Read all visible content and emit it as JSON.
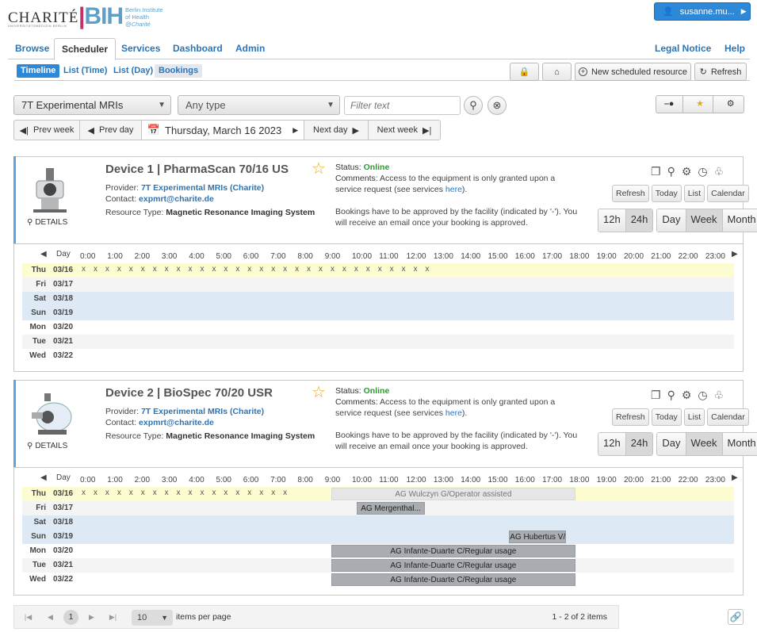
{
  "header": {
    "charite": "CHARITÉ",
    "charite_sub": "UNIVERSITÄTSMEDIZIN BERLIN",
    "bih_logo": "BIH",
    "bih_sub1": "Berlin Institute",
    "bih_sub2": "of Health",
    "bih_sub3": "@Charité",
    "user": "susanne.mu..."
  },
  "main_tabs": {
    "browse": "Browse",
    "scheduler": "Scheduler",
    "services": "Services",
    "dashboard": "Dashboard",
    "admin": "Admin",
    "legal": "Legal Notice",
    "help": "Help"
  },
  "sub_tabs": {
    "timeline": "Timeline",
    "list_time": "List (Time)",
    "list_day": "List (Day)",
    "bookings": "Bookings"
  },
  "toolbar": {
    "new_resource": "New scheduled resource",
    "refresh": "Refresh"
  },
  "filters": {
    "resource_group": "7T Experimental MRIs",
    "type": "Any type",
    "filter_placeholder": "Filter text"
  },
  "datebar": {
    "prev_week": "Prev week",
    "prev_day": "Prev day",
    "date": "Thursday, March 16 2023",
    "next_day": "Next day",
    "next_week": "Next week"
  },
  "card_common": {
    "details": "DETAILS",
    "status_label": "Status:",
    "comments_label": "Comments:",
    "comments_text": "Access to the equipment is only granted upon a service request (see services",
    "comments_link": "here",
    "approval_text": "Bookings have to be approved by the facility (indicated by '-'). You will receive an email once your booking is approved.",
    "provider_label": "Provider:",
    "contact_label": "Contact:",
    "type_label": "Resource Type:",
    "buttons": {
      "refresh": "Refresh",
      "today": "Today",
      "list": "List",
      "calendar": "Calendar",
      "h12": "12h",
      "h24": "24h",
      "day": "Day",
      "week": "Week",
      "month": "Month"
    },
    "tl_day_label": "Day",
    "hours": [
      "0:00",
      "1:00",
      "2:00",
      "3:00",
      "4:00",
      "5:00",
      "6:00",
      "7:00",
      "8:00",
      "9:00",
      "10:00",
      "11:00",
      "12:00",
      "13:00",
      "14:00",
      "15:00",
      "16:00",
      "17:00",
      "18:00",
      "19:00",
      "20:00",
      "21:00",
      "22:00",
      "23:00"
    ],
    "days": [
      {
        "name": "Thu",
        "date": "03/16"
      },
      {
        "name": "Fri",
        "date": "03/17"
      },
      {
        "name": "Sat",
        "date": "03/18"
      },
      {
        "name": "Sun",
        "date": "03/19"
      },
      {
        "name": "Mon",
        "date": "03/20"
      },
      {
        "name": "Tue",
        "date": "03/21"
      },
      {
        "name": "Wed",
        "date": "03/22"
      }
    ]
  },
  "devices": [
    {
      "title": "Device 1 | PharmaScan 70/16 US",
      "status": "Online",
      "provider": "7T Experimental MRIs (Charite)",
      "contact": "expmrt@charite.de",
      "type": "Magnetic Resonance Imaging System",
      "x_marks": "x x x x x x x x x x x x x x x x x x x x x x x x x x x x x x",
      "bookings": []
    },
    {
      "title": "Device 2 | BioSpec 70/20 USR",
      "status": "Online",
      "provider": "7T Experimental MRIs (Charite)",
      "contact": "expmrt@charite.de",
      "type": "Magnetic Resonance Imaging System",
      "x_marks": "x x x x x x x x x x x x x x x x x x",
      "bookings": [
        {
          "day": 0,
          "label": "AG Wulczyn G/Operator assisted"
        },
        {
          "day": 1,
          "label": "AG Mergenthal..."
        },
        {
          "day": 3,
          "label": "AG Hubertus V/Reg..."
        },
        {
          "day": 4,
          "label": "AG Infante-Duarte C/Regular usage"
        },
        {
          "day": 5,
          "label": "AG Infante-Duarte C/Regular usage"
        },
        {
          "day": 6,
          "label": "AG Infante-Duarte C/Regular usage"
        }
      ]
    }
  ],
  "pager": {
    "page": "1",
    "per_page": "10",
    "per_page_label": "items per page",
    "summary": "1 - 2 of 2 items"
  }
}
